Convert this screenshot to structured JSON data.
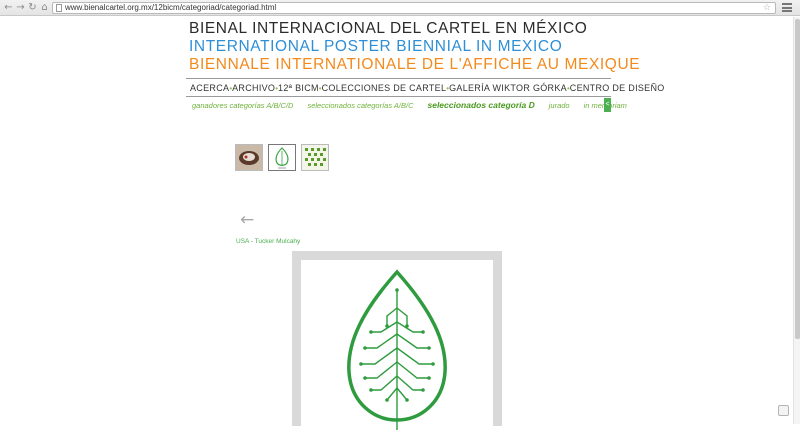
{
  "browser": {
    "url": "www.bienalcartel.org.mx/12bicm/categoriad/categoriad.html",
    "back_icon": "back-arrow-icon",
    "forward_icon": "forward-arrow-icon",
    "reload_icon": "reload-icon",
    "home_icon": "home-icon"
  },
  "header": {
    "title_es": "BIENAL INTERNACIONAL DEL CARTEL EN MÉXICO",
    "title_en": "INTERNATIONAL POSTER BIENNIAL IN MEXICO",
    "title_fr": "BIENNALE INTERNATIONALE DE L'AFFICHE AU MEXIQUE"
  },
  "nav": {
    "items": [
      "ACERCA",
      "ARCHIVO",
      "12ª BICM",
      "COLECCIONES DE CARTEL",
      "GALERÍA WIKTOR GÓRKA",
      "CENTRO DE DISEÑO"
    ],
    "separator": "•"
  },
  "subnav": {
    "items": [
      "ganadores categorías A/B/C/D",
      "seleccionados categorías A/B/C",
      "seleccionados categoría D",
      "jurado",
      "in memoriam"
    ],
    "active_index": 2,
    "toggle_label": "<"
  },
  "gallery": {
    "caption": "USA - Tucker Mulcahy",
    "back_label": "←"
  },
  "colors": {
    "title_es": "#2b2b2b",
    "title_en": "#2f8fd6",
    "title_fr": "#f28a1d",
    "accent_green": "#4caf50"
  }
}
